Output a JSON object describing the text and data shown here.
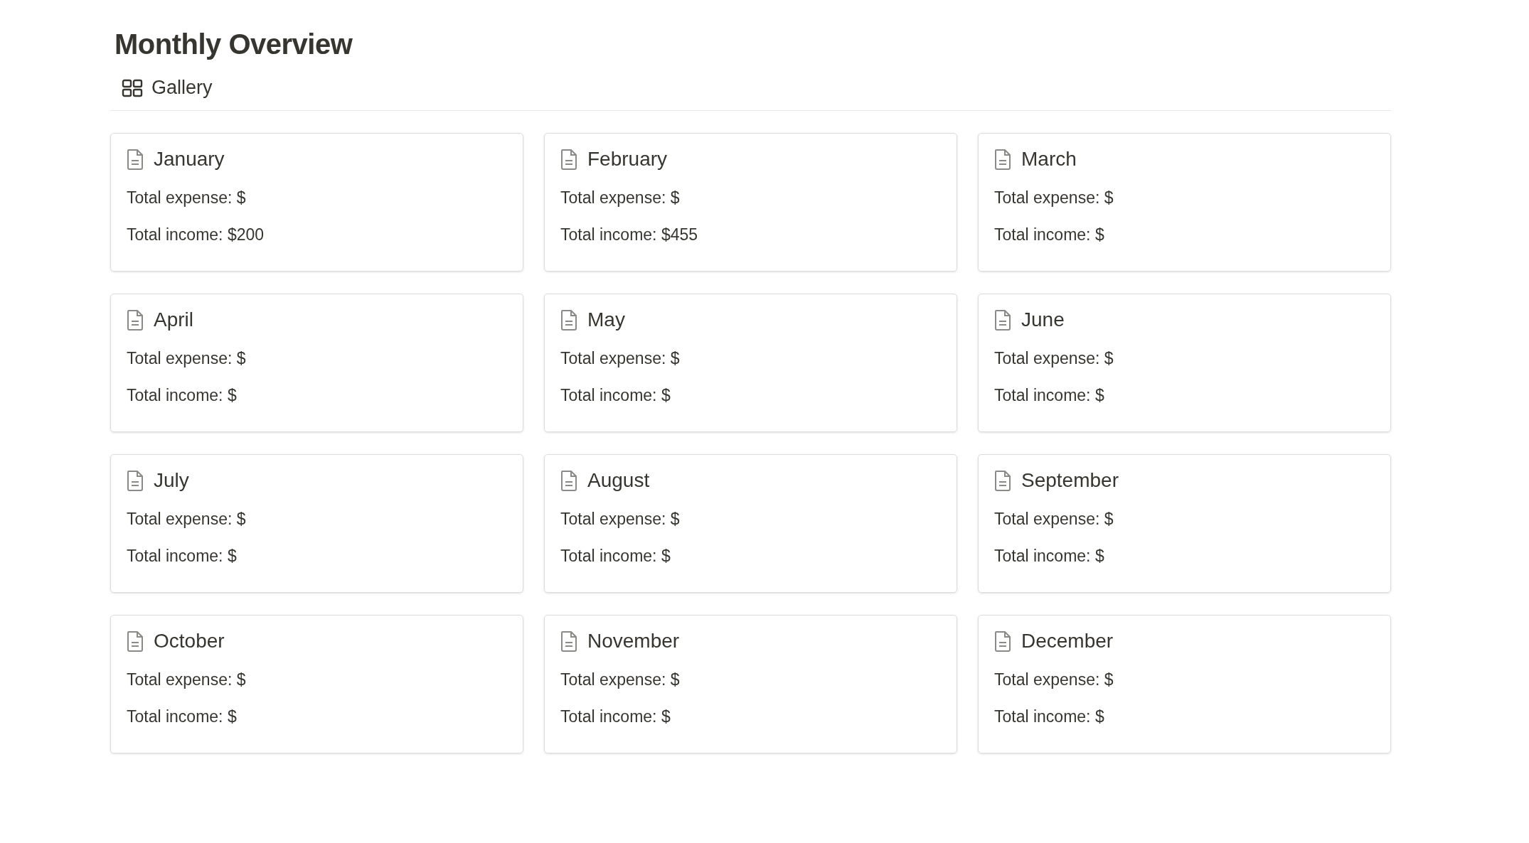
{
  "title": "Monthly Overview",
  "view": {
    "label": "Gallery"
  },
  "cards": [
    {
      "title": "January",
      "lines": [
        "Total expense: $",
        "Total income: $200"
      ]
    },
    {
      "title": "February",
      "lines": [
        "Total expense: $",
        "Total income: $455"
      ]
    },
    {
      "title": "March",
      "lines": [
        "Total expense: $",
        "Total income: $"
      ]
    },
    {
      "title": "April",
      "lines": [
        "Total expense: $",
        "Total income: $"
      ]
    },
    {
      "title": "May",
      "lines": [
        "Total expense: $",
        "Total income: $"
      ]
    },
    {
      "title": "June",
      "lines": [
        "Total expense: $",
        "Total income: $"
      ]
    },
    {
      "title": "July",
      "lines": [
        "Total expense: $",
        "Total income: $"
      ]
    },
    {
      "title": "August",
      "lines": [
        "Total expense: $",
        "Total income: $"
      ]
    },
    {
      "title": "September",
      "lines": [
        "Total expense: $",
        "Total income: $"
      ]
    },
    {
      "title": "October",
      "lines": [
        "Total expense: $",
        "Total income: $"
      ]
    },
    {
      "title": "November",
      "lines": [
        "Total expense: $",
        "Total income: $"
      ]
    },
    {
      "title": "December",
      "lines": [
        "Total expense: $",
        "Total income: $"
      ]
    }
  ]
}
